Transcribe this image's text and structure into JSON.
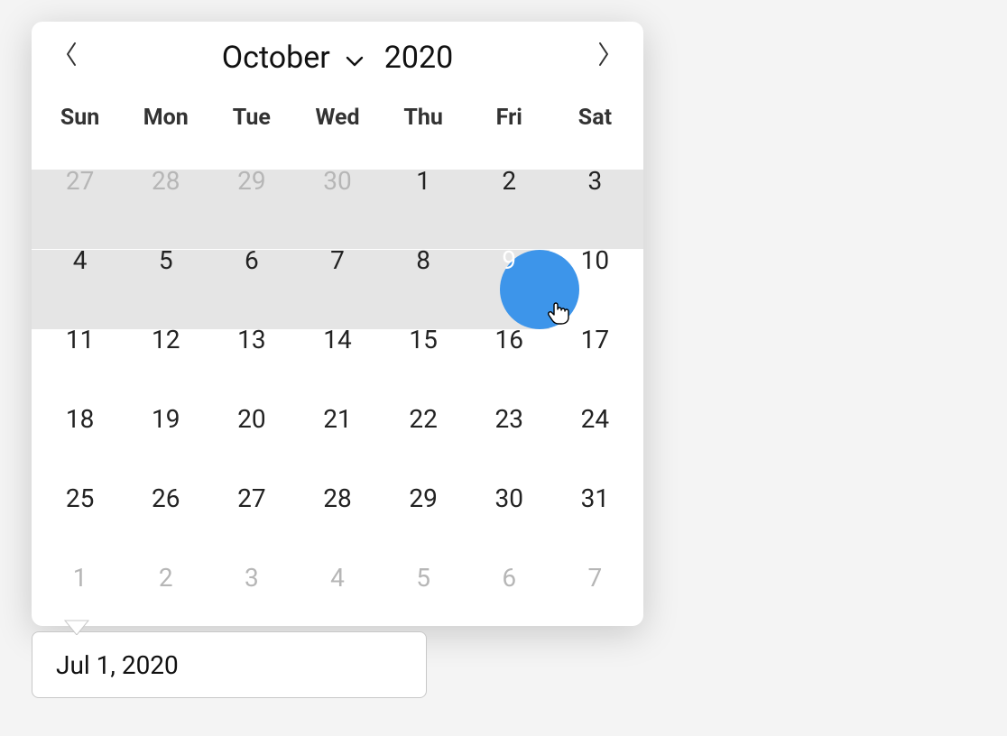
{
  "colors": {
    "hover": "#3d95ea",
    "range": "#e5e5e5"
  },
  "calendar": {
    "prev_aria": "Previous month",
    "next_aria": "Next month",
    "month": "October",
    "year": "2020",
    "weekdays": [
      "Sun",
      "Mon",
      "Tue",
      "Wed",
      "Thu",
      "Fri",
      "Sat"
    ],
    "hovered_day_index": 11,
    "days": [
      {
        "n": "27",
        "other": true
      },
      {
        "n": "28",
        "other": true
      },
      {
        "n": "29",
        "other": true
      },
      {
        "n": "30",
        "other": true
      },
      {
        "n": "1"
      },
      {
        "n": "2"
      },
      {
        "n": "3"
      },
      {
        "n": "4"
      },
      {
        "n": "5"
      },
      {
        "n": "6"
      },
      {
        "n": "7"
      },
      {
        "n": "8"
      },
      {
        "n": "9",
        "hovered": true
      },
      {
        "n": "10"
      },
      {
        "n": "11"
      },
      {
        "n": "12"
      },
      {
        "n": "13"
      },
      {
        "n": "14"
      },
      {
        "n": "15"
      },
      {
        "n": "16"
      },
      {
        "n": "17"
      },
      {
        "n": "18"
      },
      {
        "n": "19"
      },
      {
        "n": "20"
      },
      {
        "n": "21"
      },
      {
        "n": "22"
      },
      {
        "n": "23"
      },
      {
        "n": "24"
      },
      {
        "n": "25"
      },
      {
        "n": "26"
      },
      {
        "n": "27"
      },
      {
        "n": "28"
      },
      {
        "n": "29"
      },
      {
        "n": "30"
      },
      {
        "n": "31"
      },
      {
        "n": "1",
        "other": true
      },
      {
        "n": "2",
        "other": true
      },
      {
        "n": "3",
        "other": true
      },
      {
        "n": "4",
        "other": true
      },
      {
        "n": "5",
        "other": true
      },
      {
        "n": "6",
        "other": true
      },
      {
        "n": "7",
        "other": true
      }
    ]
  },
  "input": {
    "value": "Jul 1, 2020"
  }
}
